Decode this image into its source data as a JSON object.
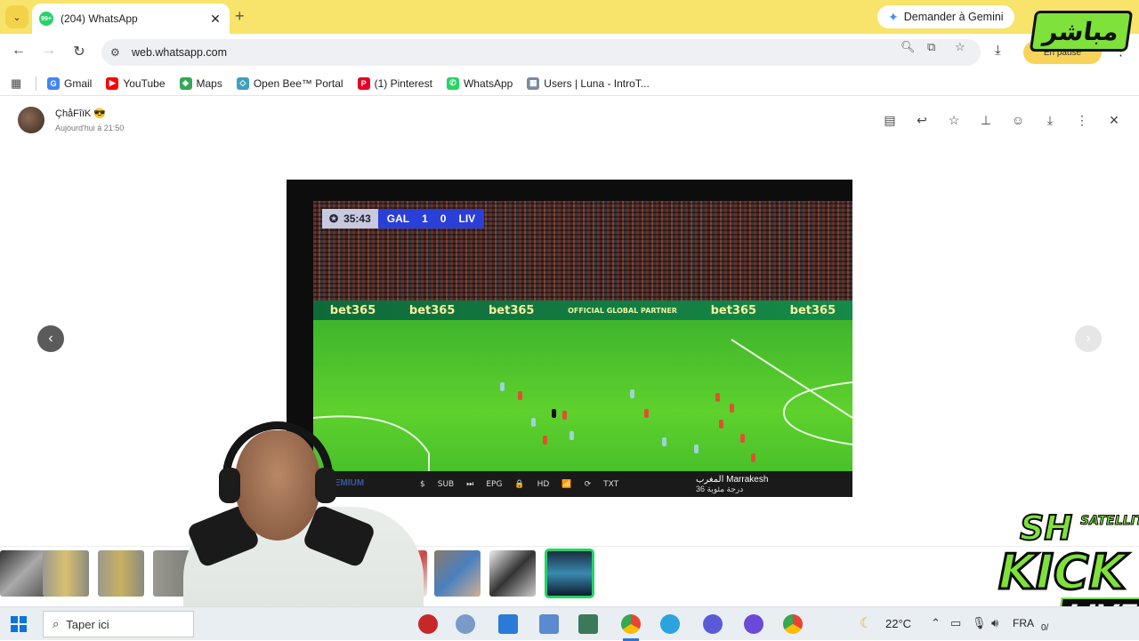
{
  "browser": {
    "tab_title": "(204) WhatsApp",
    "tab_badge": "99+",
    "tab_close": "✕",
    "new_tab": "+",
    "gemini_label": "Demander à Gemini",
    "url": "web.whatsapp.com",
    "profile_status": "En pause"
  },
  "bookmarks": [
    {
      "label": "Gmail",
      "icon": "G",
      "color": "#4285f4"
    },
    {
      "label": "YouTube",
      "icon": "▶",
      "color": "#ff0000"
    },
    {
      "label": "Maps",
      "icon": "◆",
      "color": "#34a853"
    },
    {
      "label": "Open Bee™ Portal",
      "icon": "◇",
      "color": "#3fa0c0"
    },
    {
      "label": "(1) Pinterest",
      "icon": "P",
      "color": "#e60023"
    },
    {
      "label": "WhatsApp",
      "icon": "✆",
      "color": "#25d366"
    },
    {
      "label": "Users | Luna - IntroT...",
      "icon": "▦",
      "color": "#7a8aa0"
    }
  ],
  "viewer": {
    "sender_name": "ÇhåFîïK 😎",
    "sender_time": "Aujourd'hui à 21:50",
    "prev": "‹",
    "next": "›"
  },
  "media": {
    "match_clock": "35:43",
    "home_team": "GAL",
    "home_score": "1",
    "away_score": "0",
    "away_team": "LIV",
    "ad_text": "bet365",
    "partner_text": "OFFICIAL GLOBAL PARTNER",
    "tv_buttons": [
      "$",
      "SUB",
      "⏭",
      "EPG",
      "🔒",
      "HD",
      "📶",
      "⟳",
      "TXT"
    ],
    "tv_channel": "Marrakesh",
    "tv_premium": "PREMIUM",
    "tv_channel_ar": "المغرب",
    "tv_temp": "36 درجة مئوية"
  },
  "overlays": {
    "mubasher": "مباشر",
    "sh": "SH",
    "satellite": "SATELLITE",
    "kick": "KICK",
    "live": "LIVE"
  },
  "taskbar": {
    "search_placeholder": "Taper ici",
    "temperature": "22°C",
    "language": "FRA",
    "clock_fragment": "0/"
  },
  "colors": {
    "accent_green": "#25d366",
    "tab_strip": "#f8e36b",
    "kick_green": "#7ee23a"
  }
}
